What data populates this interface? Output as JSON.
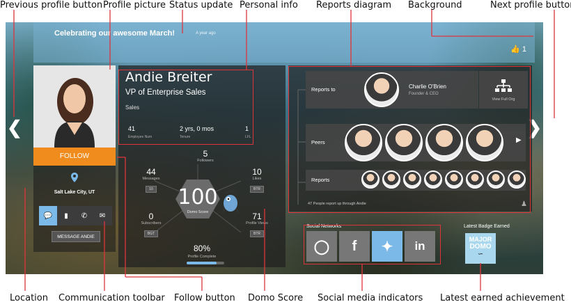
{
  "annotations": {
    "previous_profile_button": "Previous profile button",
    "profile_picture": "Profile picture",
    "status_update": "Status update",
    "personal_info": "Personal info",
    "reports_diagram": "Reports diagram",
    "background": "Background",
    "next_profile_button": "Next profile button",
    "location": "Location",
    "communication_toolbar": "Communication toolbar",
    "follow_button": "Follow button",
    "domo_score": "Domo Score",
    "social_media_indicators": "Social media indicators",
    "latest_earned_achievement": "Latest earned achievement"
  },
  "status": {
    "text": "Celebrating our awesome March!",
    "time": "A year ago",
    "likes": "1"
  },
  "profile": {
    "name": "Andie Breiter",
    "title": "VP of Enterprise Sales",
    "department": "Sales",
    "follow_label": "FOLLOW",
    "location": "Salt Lake City, UT",
    "message_label": "MESSAGE ANDIE",
    "stats": [
      {
        "value": "41",
        "caption": "Employee Num"
      },
      {
        "value": "2 yrs, 0 mos",
        "caption": "Tenure"
      },
      {
        "value": "1",
        "caption": "LFL"
      }
    ]
  },
  "metrics": {
    "followers": {
      "value": "5",
      "label": "Followers"
    },
    "messages": {
      "value": "44",
      "label": "Messages",
      "pill": "10"
    },
    "likes": {
      "value": "10",
      "label": "Likes",
      "pill": "BTR"
    },
    "subscribers": {
      "value": "0",
      "label": "Subscribers",
      "pill": "BGT"
    },
    "profile_views": {
      "value": "71",
      "label": "Profile Views",
      "pill": "BTR"
    },
    "domo_score": {
      "value": "100",
      "label": "Domo Score"
    },
    "profile_complete": {
      "value": "80%",
      "label": "Profile Complete",
      "fraction": 0.8
    }
  },
  "reports": {
    "reports_to_label": "Reports to",
    "manager_name": "Charlie O'Brien",
    "manager_title": "Founder & CEO",
    "view_org_label": "View Full Org",
    "peers_label": "Peers",
    "reports_label": "Reports",
    "report_count_note": "47 People report up through Andie"
  },
  "social": {
    "title": "Social Networks",
    "networks": [
      "instagram-icon",
      "facebook-icon",
      "twitter-icon",
      "linkedin-icon"
    ],
    "active_network": "twitter-icon"
  },
  "badge": {
    "title": "Latest Badge Earned",
    "line1": "MAJOR",
    "line2": "DOMO"
  },
  "colors": {
    "follow": "#f08c1e",
    "accent_blue": "#7ab9e8",
    "annotation_line": "#e0343b"
  }
}
